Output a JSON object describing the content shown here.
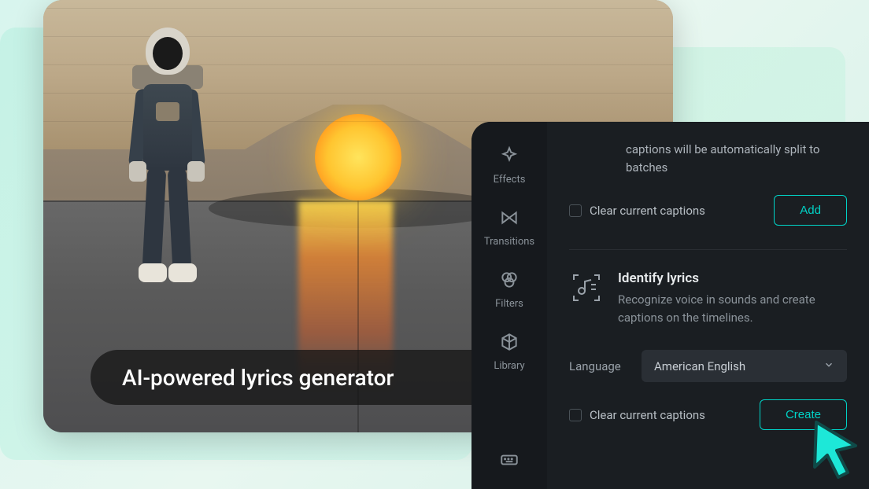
{
  "preview": {
    "caption": "AI-powered lyrics generator"
  },
  "sidebar": {
    "items": [
      {
        "label": "Effects",
        "icon": "sparkle"
      },
      {
        "label": "Transitions",
        "icon": "bowtie"
      },
      {
        "label": "Filters",
        "icon": "color-rings"
      },
      {
        "label": "Library",
        "icon": "cube"
      },
      {
        "label": "",
        "icon": "keyboard"
      }
    ]
  },
  "panel": {
    "info_text": "captions will be automatically split to batches",
    "clear_captions_label": "Clear current captions",
    "add_button": "Add",
    "feature": {
      "title": "Identify lyrics",
      "description": "Recognize voice in sounds and create captions on the timelines."
    },
    "language_label": "Language",
    "language_value": "American English",
    "clear_captions_label_2": "Clear current captions",
    "create_button": "Create"
  }
}
